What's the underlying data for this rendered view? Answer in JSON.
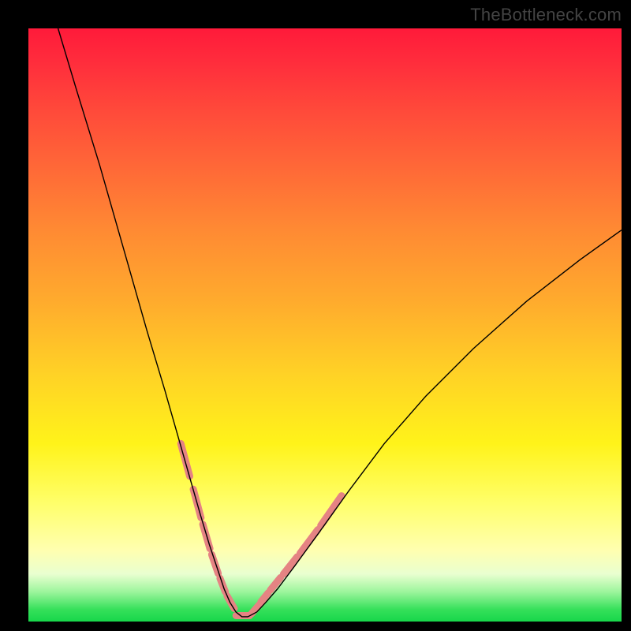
{
  "watermark": "TheBottleneck.com",
  "chart_data": {
    "type": "line",
    "title": "",
    "xlabel": "",
    "ylabel": "",
    "xlim": [
      0,
      100
    ],
    "ylim": [
      0,
      100
    ],
    "grid": false,
    "series": [
      {
        "name": "curve",
        "stroke": "#000000",
        "stroke_width": 1.4,
        "x": [
          5,
          8,
          12,
          16,
          20,
          23,
          25,
          27,
          29,
          30.5,
          32,
          33,
          34,
          35,
          36,
          37,
          38.5,
          40,
          42,
          45,
          49,
          54,
          60,
          67,
          75,
          84,
          93,
          100
        ],
        "y": [
          100,
          90,
          77,
          63,
          49,
          39,
          32,
          25,
          18,
          13,
          8.5,
          5.5,
          3.2,
          1.6,
          0.8,
          0.8,
          1.6,
          3.2,
          5.5,
          9.5,
          15,
          22,
          30,
          38,
          46,
          54,
          61,
          66
        ]
      },
      {
        "name": "valley-highlight",
        "stroke": "#e58383",
        "stroke_width": 9,
        "segmented": true,
        "segments": [
          {
            "x": [
              25.7,
              27.2
            ],
            "y": [
              30.0,
              24.5
            ]
          },
          {
            "x": [
              27.8,
              29.1
            ],
            "y": [
              22.3,
              17.5
            ]
          },
          {
            "x": [
              29.4,
              30.6
            ],
            "y": [
              16.4,
              12.3
            ]
          },
          {
            "x": [
              30.9,
              32.0
            ],
            "y": [
              11.3,
              8.1
            ]
          },
          {
            "x": [
              32.3,
              33.2
            ],
            "y": [
              7.3,
              5.0
            ]
          },
          {
            "x": [
              33.5,
              34.7
            ],
            "y": [
              4.3,
              2.2
            ]
          },
          {
            "x": [
              35.0,
              37.3
            ],
            "y": [
              1.0,
              1.0
            ]
          },
          {
            "x": [
              37.6,
              38.9
            ],
            "y": [
              1.3,
              2.8
            ]
          },
          {
            "x": [
              39.2,
              40.4
            ],
            "y": [
              3.3,
              4.8
            ]
          },
          {
            "x": [
              40.8,
              42.5
            ],
            "y": [
              5.3,
              7.4
            ]
          },
          {
            "x": [
              43.0,
              45.3
            ],
            "y": [
              8.0,
              10.9
            ]
          },
          {
            "x": [
              45.8,
              48.8
            ],
            "y": [
              11.5,
              15.5
            ]
          },
          {
            "x": [
              49.3,
              52.8
            ],
            "y": [
              16.2,
              21.2
            ]
          }
        ]
      }
    ],
    "annotations": []
  },
  "colors": {
    "background": "#000000",
    "curve": "#000000",
    "highlight": "#e58383"
  }
}
